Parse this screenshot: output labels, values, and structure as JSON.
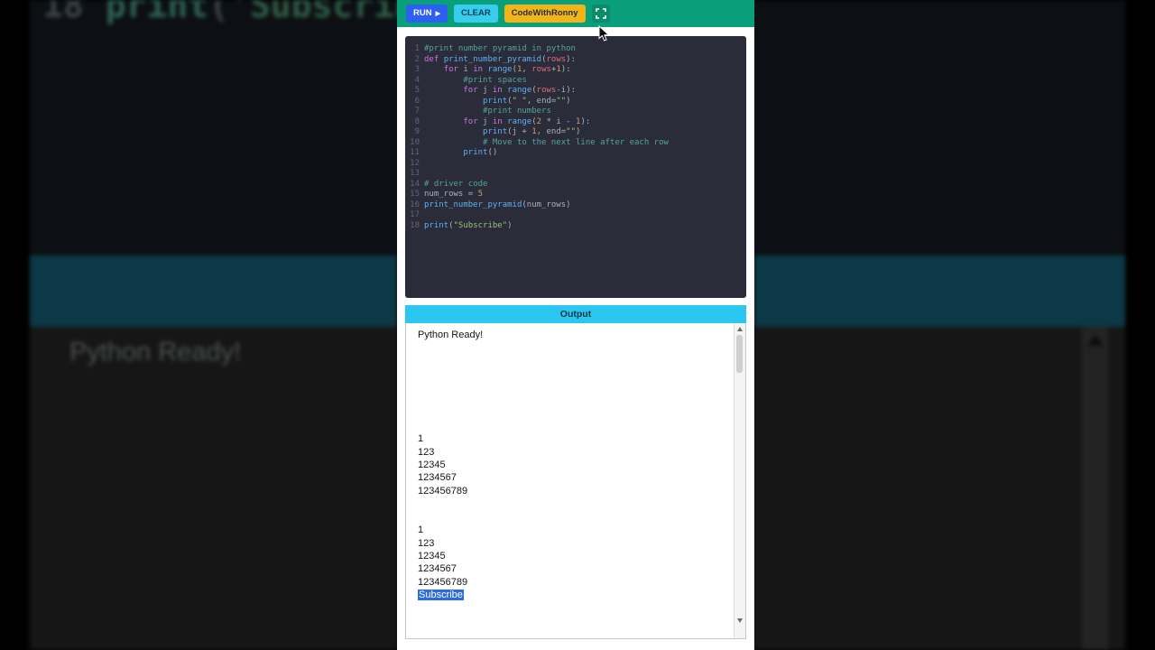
{
  "background": {
    "big_code": {
      "line_number": "18",
      "function": "print",
      "open_paren": "(",
      "string": "'Subscribe'",
      "close_paren": ")"
    },
    "ready_text": "Python Ready!"
  },
  "toolbar": {
    "run_label": "RUN",
    "run_icon": "▶",
    "clear_label": "CLEAR",
    "brand_label": "CodeWithRonny"
  },
  "editor": {
    "lines": [
      {
        "no": "1",
        "segs": [
          [
            "cmt",
            "#print number pyramid in python"
          ]
        ]
      },
      {
        "no": "2",
        "segs": [
          [
            "kw",
            "def "
          ],
          [
            "fn",
            "print_number_pyramid"
          ],
          [
            "pl",
            "("
          ],
          [
            "var",
            "rows"
          ],
          [
            "pl",
            "):"
          ]
        ]
      },
      {
        "no": "3",
        "segs": [
          [
            "pl",
            "    "
          ],
          [
            "kw",
            "for"
          ],
          [
            "pl",
            " i "
          ],
          [
            "kw",
            "in"
          ],
          [
            "pl",
            " "
          ],
          [
            "fn",
            "range"
          ],
          [
            "pl",
            "("
          ],
          [
            "num",
            "1"
          ],
          [
            "pl",
            ", "
          ],
          [
            "var",
            "rows"
          ],
          [
            "pl",
            "+"
          ],
          [
            "num",
            "1"
          ],
          [
            "pl",
            "):"
          ]
        ]
      },
      {
        "no": "4",
        "segs": [
          [
            "pl",
            "        "
          ],
          [
            "cmt",
            "#print spaces"
          ]
        ]
      },
      {
        "no": "5",
        "segs": [
          [
            "pl",
            "        "
          ],
          [
            "kw",
            "for"
          ],
          [
            "pl",
            " j "
          ],
          [
            "kw",
            "in"
          ],
          [
            "pl",
            " "
          ],
          [
            "fn",
            "range"
          ],
          [
            "pl",
            "("
          ],
          [
            "var",
            "rows"
          ],
          [
            "pl",
            "-i):"
          ]
        ]
      },
      {
        "no": "6",
        "segs": [
          [
            "pl",
            "            "
          ],
          [
            "fn",
            "print"
          ],
          [
            "pl",
            "("
          ],
          [
            "str",
            "\" \""
          ],
          [
            "pl",
            ", end="
          ],
          [
            "str",
            "\"\""
          ],
          [
            "pl",
            ")"
          ]
        ]
      },
      {
        "no": "7",
        "segs": [
          [
            "pl",
            "            "
          ],
          [
            "cmt",
            "#print numbers"
          ]
        ]
      },
      {
        "no": "8",
        "segs": [
          [
            "pl",
            "        "
          ],
          [
            "kw",
            "for"
          ],
          [
            "pl",
            " j "
          ],
          [
            "kw",
            "in"
          ],
          [
            "pl",
            " "
          ],
          [
            "fn",
            "range"
          ],
          [
            "pl",
            "("
          ],
          [
            "num",
            "2"
          ],
          [
            "pl",
            " * i - "
          ],
          [
            "num",
            "1"
          ],
          [
            "pl",
            "):"
          ]
        ]
      },
      {
        "no": "9",
        "segs": [
          [
            "pl",
            "            "
          ],
          [
            "fn",
            "print"
          ],
          [
            "pl",
            "(j + "
          ],
          [
            "num",
            "1"
          ],
          [
            "pl",
            ", end="
          ],
          [
            "str",
            "\"\""
          ],
          [
            "pl",
            ")"
          ]
        ]
      },
      {
        "no": "10",
        "segs": [
          [
            "pl",
            "            "
          ],
          [
            "cmt",
            "# Move to the next line after each row"
          ]
        ]
      },
      {
        "no": "11",
        "segs": [
          [
            "pl",
            "        "
          ],
          [
            "fn",
            "print"
          ],
          [
            "pl",
            "()"
          ]
        ]
      },
      {
        "no": "12",
        "segs": []
      },
      {
        "no": "13",
        "segs": []
      },
      {
        "no": "14",
        "segs": [
          [
            "cmt",
            "# driver code"
          ]
        ]
      },
      {
        "no": "15",
        "segs": [
          [
            "pl",
            "num_rows = "
          ],
          [
            "num",
            "5"
          ]
        ]
      },
      {
        "no": "16",
        "segs": [
          [
            "fn",
            "print_number_pyramid"
          ],
          [
            "pl",
            "(num_rows)"
          ]
        ]
      },
      {
        "no": "17",
        "segs": []
      },
      {
        "no": "18",
        "segs": [
          [
            "fn",
            "print"
          ],
          [
            "pl",
            "("
          ],
          [
            "str",
            "\"Subscribe\""
          ],
          [
            "pl",
            ")"
          ]
        ]
      }
    ]
  },
  "output": {
    "title": "Output",
    "lines": [
      {
        "t": "Python Ready!"
      },
      {
        "t": ""
      },
      {
        "t": ""
      },
      {
        "t": ""
      },
      {
        "t": ""
      },
      {
        "t": ""
      },
      {
        "t": ""
      },
      {
        "t": ""
      },
      {
        "t": "1"
      },
      {
        "t": "123"
      },
      {
        "t": "12345"
      },
      {
        "t": "1234567"
      },
      {
        "t": "123456789"
      },
      {
        "t": ""
      },
      {
        "t": ""
      },
      {
        "t": "1"
      },
      {
        "t": "123"
      },
      {
        "t": "12345"
      },
      {
        "t": "1234567"
      },
      {
        "t": "123456789"
      },
      {
        "t": "Subscribe",
        "hl": true
      }
    ]
  },
  "icons": {
    "play": "▶",
    "fullscreen": "expand-corners",
    "scroll_up": "triangle-up",
    "scroll_down": "triangle-down"
  },
  "colors": {
    "toolbar_bg": "#0a9f7b",
    "run_button_bg": "#2c5ff2",
    "clear_button_bg": "#38cdef",
    "brand_button_bg": "#f2b418",
    "fullscreen_button_bg": "#0d8a6a",
    "editor_bg": "#2a2c3a",
    "output_bar_bg": "#2cc7f0",
    "subscribe_highlight_bg": "#2e6be0",
    "background_band": "#0d3845",
    "syntax": {
      "keyword": "#c678dd",
      "function": "#61afef",
      "string": "#98c379",
      "number": "#d19a66",
      "variable": "#e06c75",
      "comment": "#56a39a",
      "plain": "#a9b1bd",
      "line_number": "#5e6776"
    }
  }
}
